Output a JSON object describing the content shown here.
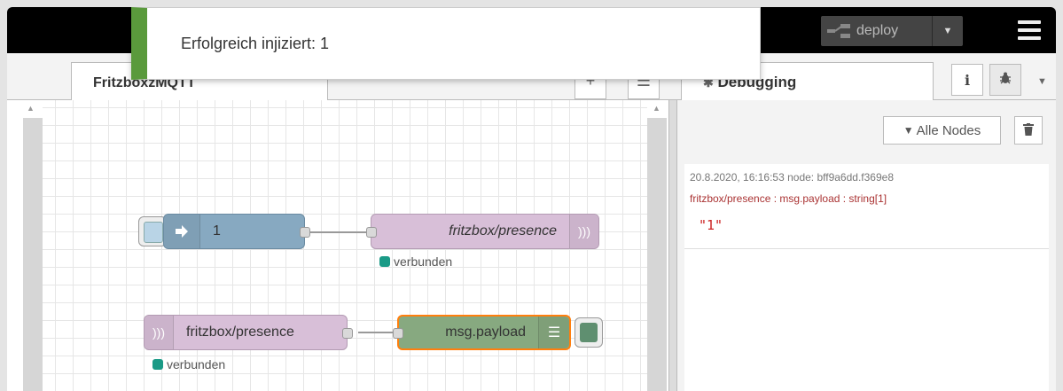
{
  "header": {
    "deploy_label": "deploy",
    "deploy_icon": "deploy-icon",
    "menu_icon": "hamburger-menu-icon"
  },
  "notification": {
    "message": "Erfolgreich injiziert: 1",
    "accent": "#5a9a3c"
  },
  "tabs": {
    "flow_tab_label": "FritzboxzMQTT",
    "add_icon": "plus-icon",
    "list_icon": "list-icon"
  },
  "flow": {
    "inject_node_label": "1",
    "mqtt_out_label": "fritzbox/presence",
    "mqtt_out_status": "verbunden",
    "mqtt_in_label": "fritzbox/presence",
    "mqtt_in_status": "verbunden",
    "debug_node_label": "msg.payload",
    "colors": {
      "inject": "#87a9c1",
      "mqtt": "#d8bfd8",
      "debug": "#87a980",
      "status_connected": "#1a9a86",
      "selected_outline": "#ff7f0e"
    }
  },
  "sidebar": {
    "tab_label": "Debugging",
    "info_label": "i",
    "filter_label": "Alle Nodes",
    "messages": [
      {
        "meta": "20.8.2020, 16:16:53   node: bff9a6dd.f369e8",
        "topic": "fritzbox/presence : msg.payload : string[1]",
        "value": "\"1\""
      }
    ]
  }
}
